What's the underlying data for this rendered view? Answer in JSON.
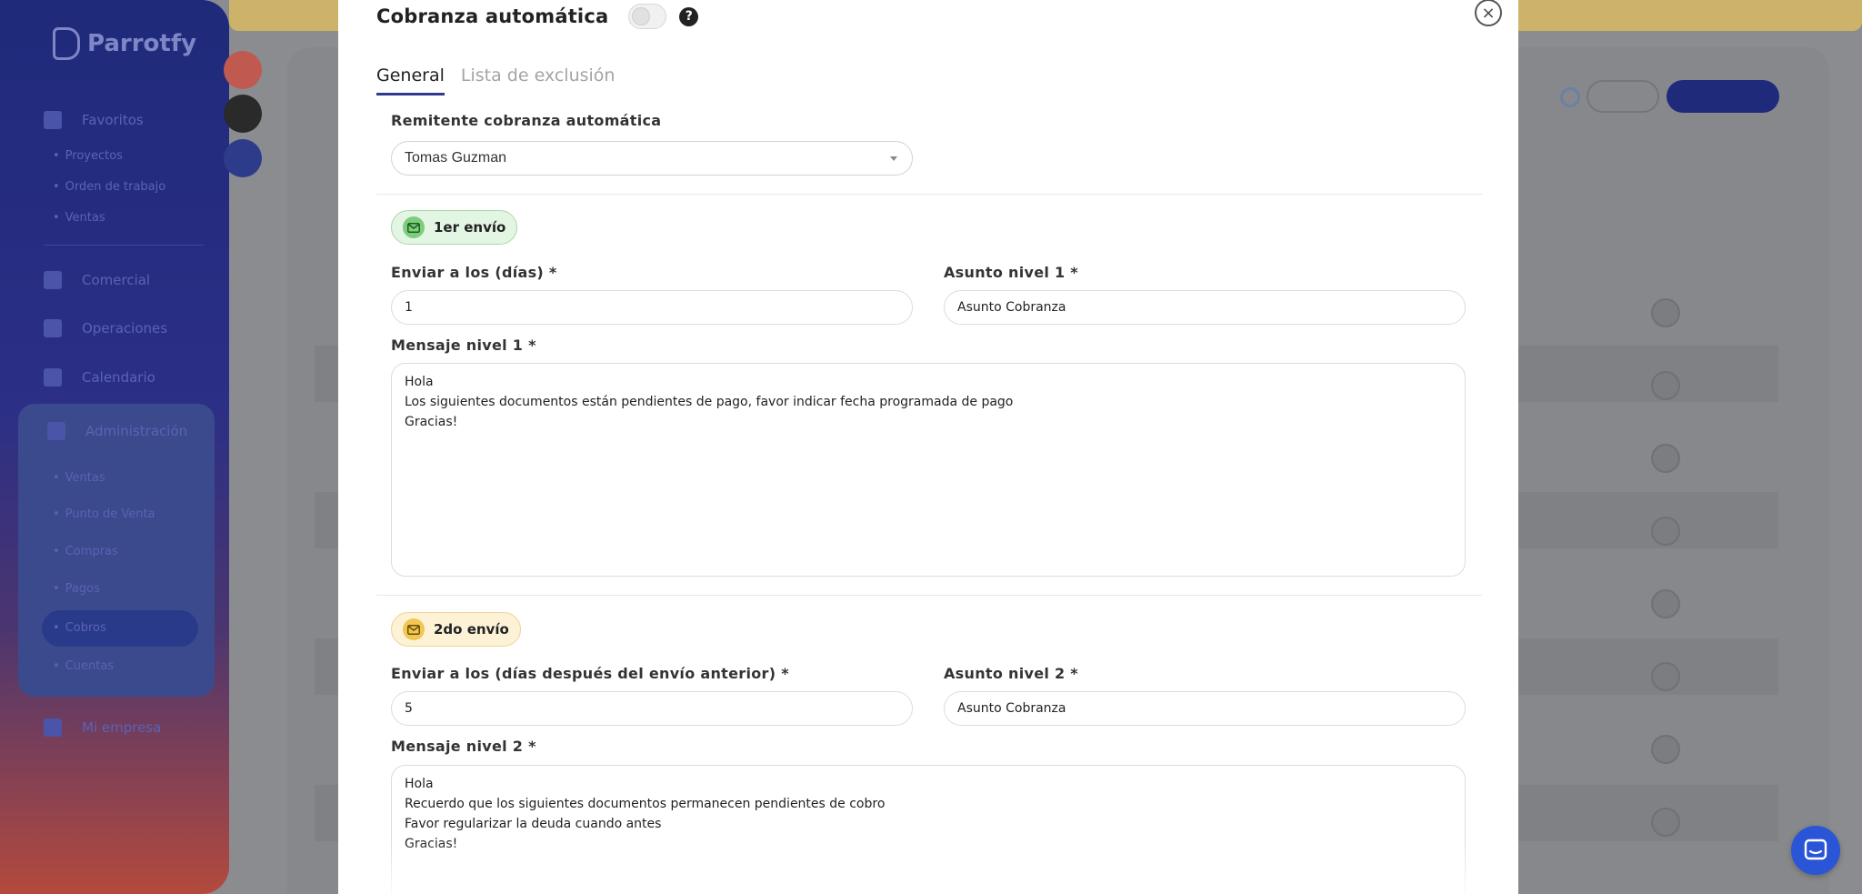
{
  "modal": {
    "title": "Cobranza automática",
    "enabled": false,
    "close_glyph": "×",
    "help_glyph": "?",
    "tabs": [
      {
        "label": "General",
        "active": true
      },
      {
        "label": "Lista de exclusión",
        "active": false
      }
    ],
    "sender": {
      "label": "Remitente cobranza automática",
      "value": "Tomas Guzman"
    },
    "levels": [
      {
        "badge": "1er envío",
        "badge_color": "green",
        "days_label": "Enviar a los (días) *",
        "days_value": "1",
        "subject_label": "Asunto nivel 1 *",
        "subject_value": "Asunto Cobranza",
        "message_label": "Mensaje nivel 1 *",
        "message_lines": [
          "Hola",
          "Los siguientes documentos están pendientes de pago, favor indicar fecha programada de pago",
          "Gracias!"
        ]
      },
      {
        "badge": "2do envío",
        "badge_color": "yellow",
        "days_label": "Enviar a los (días después del envío anterior) *",
        "days_value": "5",
        "subject_label": "Asunto nivel 2 *",
        "subject_value": "Asunto Cobranza",
        "message_label": "Mensaje nivel 2 *",
        "message_lines": [
          "Hola",
          "Recuerdo que los siguientes documentos permanecen pendientes de cobro",
          "Favor regularizar la deuda cuando antes",
          "Gracias!"
        ]
      }
    ]
  },
  "background": {
    "logo": "Parrotfy",
    "nav": [
      {
        "label": "Favoritos",
        "icon": "bookmark-icon"
      },
      {
        "label": "Comercial",
        "icon": "chart-icon"
      },
      {
        "label": "Operaciones",
        "icon": "clipboard-icon"
      },
      {
        "label": "Calendario",
        "icon": "calendar-icon"
      },
      {
        "label": "Administración",
        "icon": "bank-icon"
      },
      {
        "label": "Mi empresa",
        "icon": "building-icon"
      }
    ],
    "favorites_sub": [
      "Proyectos",
      "Orden de trabajo",
      "Ventas"
    ],
    "admin_sub": [
      "Ventas",
      "Punto de Venta",
      "Compras",
      "Pagos",
      "Cobros",
      "Cuentas"
    ]
  },
  "colors": {
    "accent": "#2f3a8f",
    "badge_green": "#7ccd7c",
    "badge_yellow": "#f1c654",
    "chat": "#2a55d6"
  }
}
